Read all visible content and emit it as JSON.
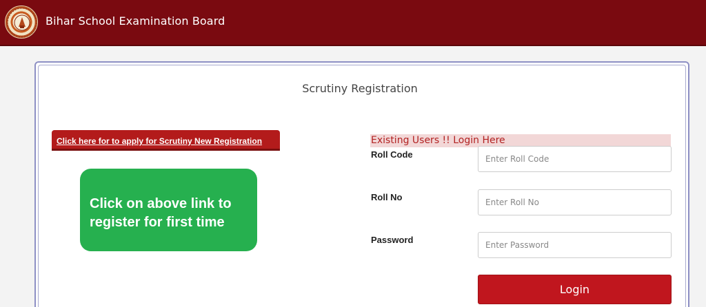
{
  "header": {
    "title": "Bihar School Examination Board",
    "logo_icon": "bseb-emblem-icon",
    "background": "#7a0a10"
  },
  "main": {
    "title": "Scrutiny Registration",
    "new_registration_link": "Click here for to apply for Scrutiny New Registration",
    "info_box": {
      "line1": "Click on above link to",
      "line2": "register for first time",
      "background": "#26b04f"
    }
  },
  "login": {
    "banner": "Existing Users !! Login Here",
    "fields": [
      {
        "label": "Roll Code",
        "placeholder": "Enter Roll Code"
      },
      {
        "label": "Roll No",
        "placeholder": "Enter Roll No"
      },
      {
        "label": "Password",
        "placeholder": "Enter Password"
      }
    ],
    "button_label": "Login",
    "button_color": "#c0161e"
  }
}
